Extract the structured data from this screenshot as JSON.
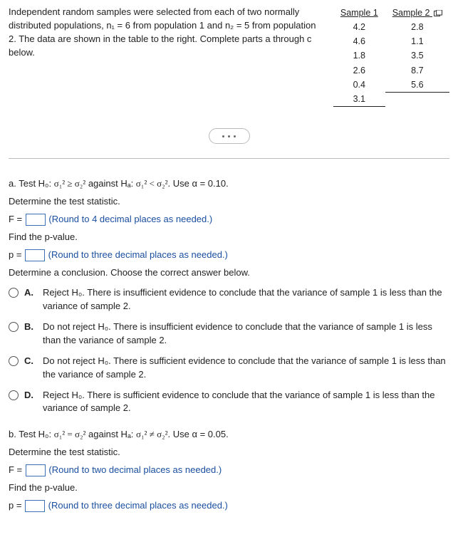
{
  "intro": "Independent random samples were selected from each of two normally distributed populations, n₁ = 6 from population 1 and n₂ = 5 from population 2. The data are shown in the table to the right. Complete parts a through c below.",
  "table": {
    "h1": "Sample 1",
    "h2": "Sample 2",
    "s1": [
      "4.2",
      "4.6",
      "1.8",
      "2.6",
      "0.4",
      "3.1"
    ],
    "s2": [
      "2.8",
      "1.1",
      "3.5",
      "8.7",
      "5.6",
      ""
    ]
  },
  "a": {
    "prompt_lead": "a. Test H₀: ",
    "hyp0": "σ₁² ≥ σ₂²",
    "mid": " against Hₐ: ",
    "hypA": "σ₁² < σ₂²",
    "tail": ". Use α = 0.10.",
    "det": "Determine the test statistic.",
    "Feq": "F = ",
    "Fhint": "(Round to 4 decimal places as needed.)",
    "findp": "Find the p-value.",
    "peq": "p = ",
    "phint": "(Round to three decimal places as needed.)",
    "concl": "Determine a conclusion. Choose the correct answer below."
  },
  "opts": {
    "A": "Reject H₀. There is insufficient evidence to conclude that the variance of sample 1 is less than the variance of sample 2.",
    "B": "Do not reject H₀. There is insufficient evidence to conclude that the variance of sample 1 is less than the variance of sample 2.",
    "C": "Do not reject H₀. There is sufficient evidence to conclude that the variance of sample 1 is less than the variance of sample 2.",
    "D": "Reject H₀. There is sufficient evidence to conclude that the variance of sample 1 is less than the variance of sample 2."
  },
  "b": {
    "prompt_lead": "b. Test H₀: ",
    "hyp0": "σ₁² = σ₂²",
    "mid": " against Hₐ: ",
    "hypA": "σ₁² ≠ σ₂²",
    "tail": ". Use α = 0.05.",
    "det": "Determine the test statistic.",
    "Feq": "F = ",
    "Fhint": "(Round to two decimal places as needed.)",
    "findp": "Find the p-value.",
    "peq": "p = ",
    "phint": "(Round to three decimal places as needed.)"
  }
}
